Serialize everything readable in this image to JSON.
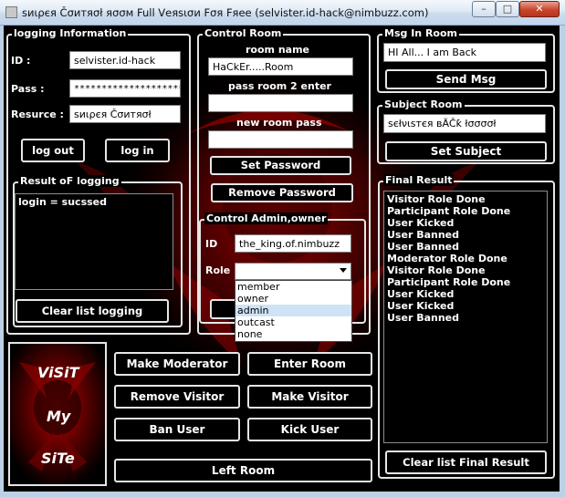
{
  "window": {
    "title": "ѕиιρєя Čσитяσł яσσм Full Vеяѕισи Fσя Fяее (selvister.id-hack@nimbuzz.com)",
    "min_symbol": "–",
    "max_symbol": "□",
    "close_symbol": "✕"
  },
  "logging": {
    "title": "logging Information",
    "id_label": "ID :",
    "id_value": "selvister.id-hack",
    "pass_label": "Pass :",
    "pass_value": "********************",
    "resurce_label": "Resurce :",
    "resurce_value": "ѕиιρєя Čσитяσł",
    "logout_label": "log out",
    "login_label": "log in"
  },
  "result_logging": {
    "title": "Result oF logging",
    "items": [
      "login = sucssed"
    ],
    "clear_label": "Clear list logging"
  },
  "control_room": {
    "title": "Control Room",
    "room_name_label": "room name",
    "room_name_value": "HaCkEr.....Room",
    "pass_room_label": "pass room 2 enter",
    "pass_room_value": "",
    "new_pass_label": "new room pass",
    "new_pass_value": "",
    "set_password_label": "Set Password",
    "remove_password_label": "Remove Password"
  },
  "control_admin": {
    "title": "Control Admin,owner",
    "id_label": "ID",
    "id_value": "the_king.of.nimbuzz",
    "role_label": "Role",
    "role_value": "",
    "role_options": [
      "member",
      "owner",
      "admin",
      "outcast",
      "none"
    ],
    "highlighted_option": "admin"
  },
  "msg_in_room": {
    "title": "Msg In Room",
    "value": "HI All... I am Back",
    "send_label": "Send Msg"
  },
  "subject_room": {
    "title": "Subject Room",
    "value": "ѕєłνιѕтєя вÄČƙ łσσσσł",
    "set_label": "Set Subject"
  },
  "final_result": {
    "title": "Final Result",
    "items": [
      "Visitor Role Done",
      "Participant Role Done",
      "User Kicked",
      "User Banned",
      "User Banned",
      "Moderator Role Done",
      "Visitor Role Done",
      "Participant Role Done",
      "User Kicked",
      "User Kicked",
      "User Banned"
    ],
    "clear_label": "Clear list Final Result"
  },
  "actions": {
    "make_moderator": "Make Moderator",
    "enter_room": "Enter Room",
    "remove_visitor": "Remove Visitor",
    "make_visitor": "Make Visitor",
    "ban_user": "Ban User",
    "kick_user": "Kick User",
    "left_room": "Left Room"
  },
  "visit_site": {
    "line1": "ViSiT",
    "line2": "My",
    "line3": "SiTe"
  },
  "colors": {
    "background": "#000000",
    "border": "#e6e6e6",
    "accent_red": "#a00000"
  }
}
